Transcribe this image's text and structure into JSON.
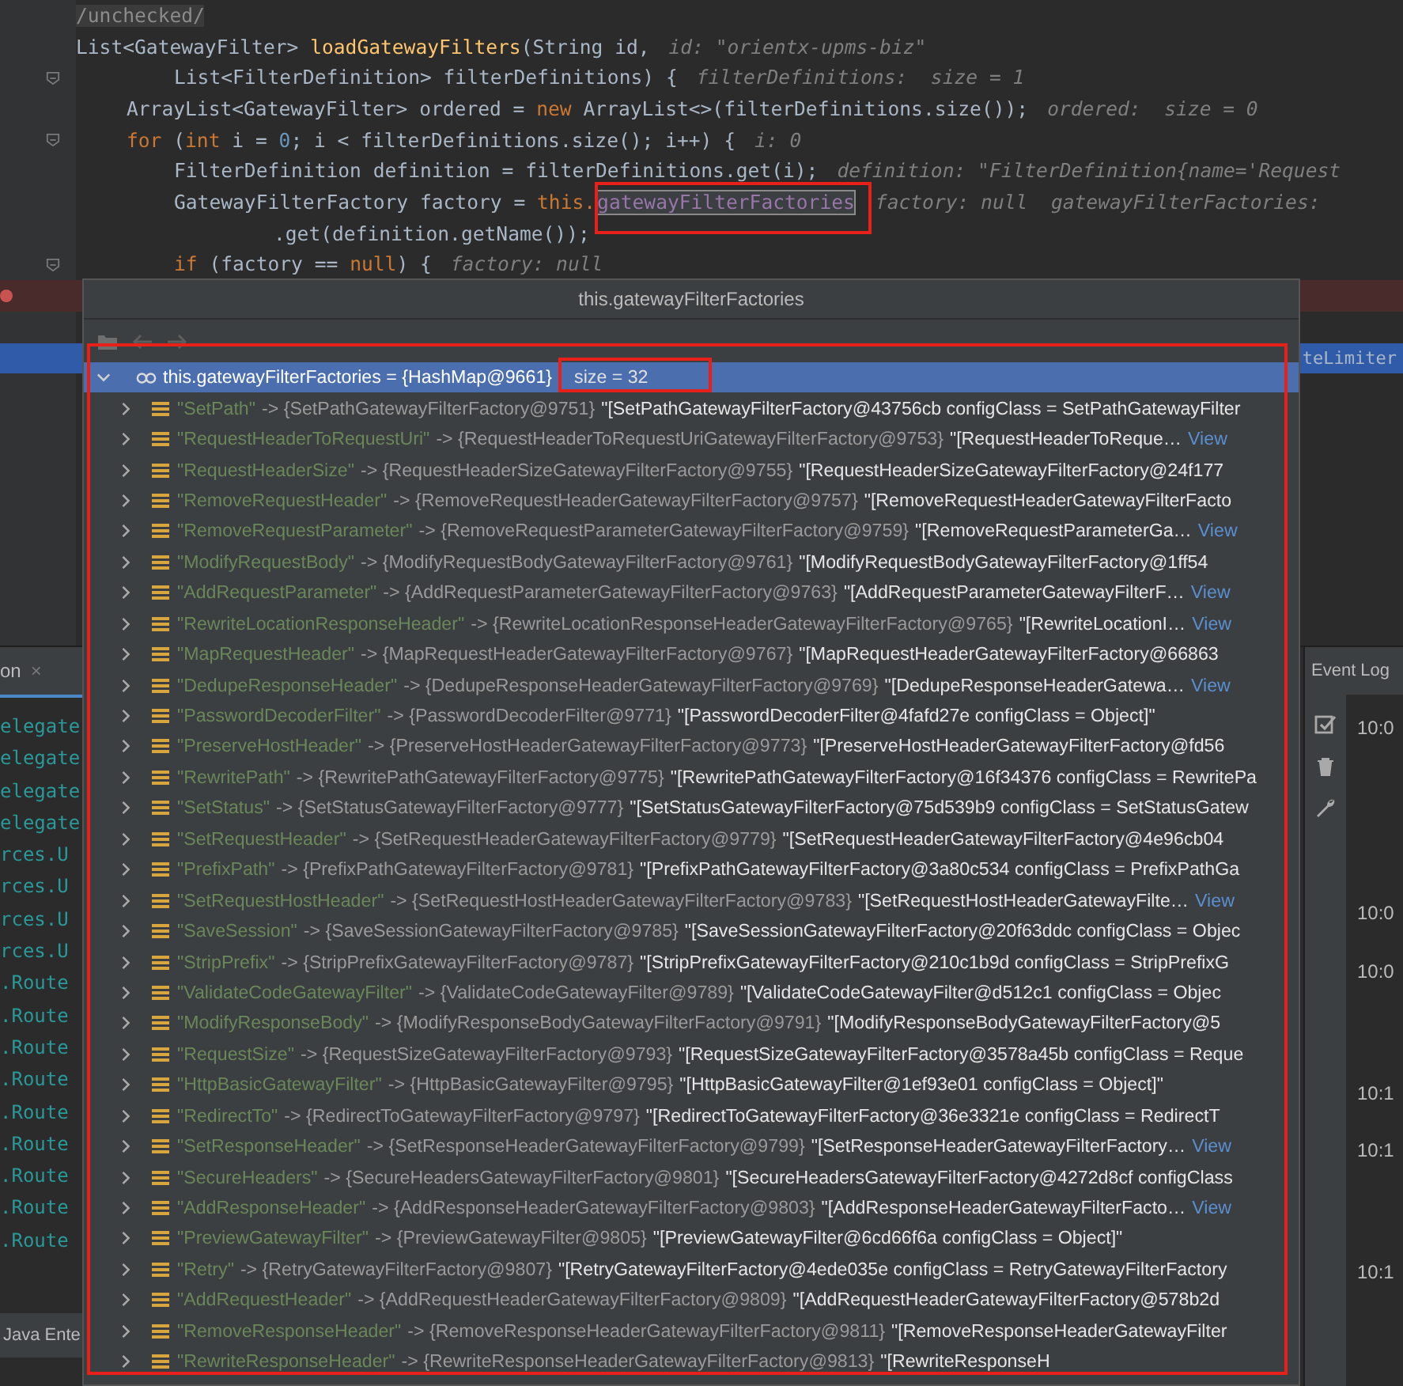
{
  "editor": {
    "lines": [
      {
        "kind": "normal",
        "segments": [
          {
            "kind": "comment",
            "text": "/unchecked/"
          }
        ]
      },
      {
        "kind": "normal",
        "segments": [
          {
            "kind": "plain",
            "text": "List<GatewayFilter> "
          },
          {
            "kind": "fn",
            "text": "loadGatewayFilters"
          },
          {
            "kind": "plain",
            "text": "(String id,"
          },
          {
            "kind": "hint",
            "text": "id: \"orientx-upms-biz\""
          }
        ]
      },
      {
        "kind": "normal",
        "fold": true,
        "segments": [
          {
            "kind": "plain",
            "text": "List<FilterDefinition> filterDefinitions) {"
          },
          {
            "kind": "hint",
            "text": "filterDefinitions:  size = 1"
          }
        ]
      },
      {
        "kind": "normal",
        "segments": [
          {
            "kind": "plain",
            "text": "ArrayList<GatewayFilter> ordered = "
          },
          {
            "kind": "kw",
            "text": "new"
          },
          {
            "kind": "plain",
            "text": " ArrayList<>(filterDefinitions.size());"
          },
          {
            "kind": "hint",
            "text": "ordered:  size = 0"
          }
        ]
      },
      {
        "kind": "normal",
        "fold": true,
        "segments": [
          {
            "kind": "kw",
            "text": "for"
          },
          {
            "kind": "plain",
            "text": " ("
          },
          {
            "kind": "kw",
            "text": "int"
          },
          {
            "kind": "plain",
            "text": " i = "
          },
          {
            "kind": "num",
            "text": "0"
          },
          {
            "kind": "plain",
            "text": "; i < filterDefinitions.size(); i++) {"
          },
          {
            "kind": "hint",
            "text": "i: 0"
          }
        ]
      },
      {
        "kind": "normal",
        "segments": [
          {
            "kind": "plain",
            "text": "FilterDefinition definition = filterDefinitions.get(i);"
          },
          {
            "kind": "hint",
            "text": "definition: \"FilterDefinition{name='Request"
          }
        ]
      },
      {
        "kind": "normal",
        "segments": [
          {
            "kind": "plain",
            "text": "GatewayFilterFactory factory = "
          },
          {
            "kind": "kw",
            "text": "this."
          },
          {
            "kind": "field",
            "text": "gatewayFilterFactories"
          },
          {
            "kind": "hint",
            "text": "factory: null  gatewayFilterFactories:"
          }
        ]
      },
      {
        "kind": "normal",
        "segments": [
          {
            "kind": "plain",
            "text": ".get(definition.getName());"
          }
        ]
      },
      {
        "kind": "normal",
        "fold": true,
        "segments": [
          {
            "kind": "kw",
            "text": "if"
          },
          {
            "kind": "plain",
            "text": " (factory == "
          },
          {
            "kind": "kw",
            "text": "null"
          },
          {
            "kind": "plain",
            "text": ") {"
          },
          {
            "kind": "hint",
            "text": "factory: null"
          }
        ]
      },
      {
        "kind": "breakpoint"
      },
      {
        "kind": "normal"
      },
      {
        "kind": "current",
        "segments": [
          {
            "kind": "plain",
            "text": "teLimiter"
          }
        ]
      }
    ]
  },
  "popup": {
    "title": "this.gatewayFilterFactories",
    "root": {
      "name": "this.gatewayFilterFactories = {HashMap@9661}",
      "size": "size = 32",
      "expanded": true,
      "selected": true,
      "children": [
        {
          "key": "\"SetPath\"",
          "ref": "-> {SetPathGatewayFilterFactory@9751}",
          "text": "\"[SetPathGatewayFilterFactory@43756cb configClass = SetPathGatewayFilter",
          "expanded": false
        },
        {
          "key": "\"RequestHeaderToRequestUri\"",
          "ref": "-> {RequestHeaderToRequestUriGatewayFilterFactory@9753}",
          "text": "\"[RequestHeaderToReque…",
          "link": "View",
          "expanded": false
        },
        {
          "key": "\"RequestHeaderSize\"",
          "ref": "-> {RequestHeaderSizeGatewayFilterFactory@9755}",
          "text": "\"[RequestHeaderSizeGatewayFilterFactory@24f177",
          "expanded": false
        },
        {
          "key": "\"RemoveRequestHeader\"",
          "ref": "-> {RemoveRequestHeaderGatewayFilterFactory@9757}",
          "text": "\"[RemoveRequestHeaderGatewayFilterFacto",
          "expanded": false
        },
        {
          "key": "\"RemoveRequestParameter\"",
          "ref": "-> {RemoveRequestParameterGatewayFilterFactory@9759}",
          "text": "\"[RemoveRequestParameterGa…",
          "link": "View",
          "expanded": false
        },
        {
          "key": "\"ModifyRequestBody\"",
          "ref": "-> {ModifyRequestBodyGatewayFilterFactory@9761}",
          "text": "\"[ModifyRequestBodyGatewayFilterFactory@1ff54",
          "expanded": false
        },
        {
          "key": "\"AddRequestParameter\"",
          "ref": "-> {AddRequestParameterGatewayFilterFactory@9763}",
          "text": "\"[AddRequestParameterGatewayFilterF…",
          "link": "View",
          "expanded": false
        },
        {
          "key": "\"RewriteLocationResponseHeader\"",
          "ref": "-> {RewriteLocationResponseHeaderGatewayFilterFactory@9765}",
          "text": "\"[RewriteLocationI…",
          "link": "View",
          "expanded": false
        },
        {
          "key": "\"MapRequestHeader\"",
          "ref": "-> {MapRequestHeaderGatewayFilterFactory@9767}",
          "text": "\"[MapRequestHeaderGatewayFilterFactory@66863",
          "expanded": false
        },
        {
          "key": "\"DedupeResponseHeader\"",
          "ref": "-> {DedupeResponseHeaderGatewayFilterFactory@9769}",
          "text": "\"[DedupeResponseHeaderGatewa…",
          "link": "View",
          "expanded": false
        },
        {
          "key": "\"PasswordDecoderFilter\"",
          "ref": "-> {PasswordDecoderFilter@9771}",
          "text": "\"[PasswordDecoderFilter@4fafd27e configClass = Object]\"",
          "expanded": false
        },
        {
          "key": "\"PreserveHostHeader\"",
          "ref": "-> {PreserveHostHeaderGatewayFilterFactory@9773}",
          "text": "\"[PreserveHostHeaderGatewayFilterFactory@fd56",
          "expanded": false
        },
        {
          "key": "\"RewritePath\"",
          "ref": "-> {RewritePathGatewayFilterFactory@9775}",
          "text": "\"[RewritePathGatewayFilterFactory@16f34376 configClass = RewritePa",
          "expanded": false
        },
        {
          "key": "\"SetStatus\"",
          "ref": "-> {SetStatusGatewayFilterFactory@9777}",
          "text": "\"[SetStatusGatewayFilterFactory@75d539b9 configClass = SetStatusGatew",
          "expanded": false
        },
        {
          "key": "\"SetRequestHeader\"",
          "ref": "-> {SetRequestHeaderGatewayFilterFactory@9779}",
          "text": "\"[SetRequestHeaderGatewayFilterFactory@4e96cb04",
          "expanded": false
        },
        {
          "key": "\"PrefixPath\"",
          "ref": "-> {PrefixPathGatewayFilterFactory@9781}",
          "text": "\"[PrefixPathGatewayFilterFactory@3a80c534 configClass = PrefixPathGa",
          "expanded": false
        },
        {
          "key": "\"SetRequestHostHeader\"",
          "ref": "-> {SetRequestHostHeaderGatewayFilterFactory@9783}",
          "text": "\"[SetRequestHostHeaderGatewayFilte…",
          "link": "View",
          "expanded": false
        },
        {
          "key": "\"SaveSession\"",
          "ref": "-> {SaveSessionGatewayFilterFactory@9785}",
          "text": "\"[SaveSessionGatewayFilterFactory@20f63ddc configClass = Objec",
          "expanded": false
        },
        {
          "key": "\"StripPrefix\"",
          "ref": "-> {StripPrefixGatewayFilterFactory@9787}",
          "text": "\"[StripPrefixGatewayFilterFactory@210c1b9d configClass = StripPrefixG",
          "expanded": false
        },
        {
          "key": "\"ValidateCodeGatewayFilter\"",
          "ref": "-> {ValidateCodeGatewayFilter@9789}",
          "text": "\"[ValidateCodeGatewayFilter@d512c1 configClass = Objec",
          "expanded": false
        },
        {
          "key": "\"ModifyResponseBody\"",
          "ref": "-> {ModifyResponseBodyGatewayFilterFactory@9791}",
          "text": "\"[ModifyResponseBodyGatewayFilterFactory@5",
          "expanded": false
        },
        {
          "key": "\"RequestSize\"",
          "ref": "-> {RequestSizeGatewayFilterFactory@9793}",
          "text": "\"[RequestSizeGatewayFilterFactory@3578a45b configClass = Reque",
          "expanded": false
        },
        {
          "key": "\"HttpBasicGatewayFilter\"",
          "ref": "-> {HttpBasicGatewayFilter@9795}",
          "text": "\"[HttpBasicGatewayFilter@1ef93e01 configClass = Object]\"",
          "expanded": false
        },
        {
          "key": "\"RedirectTo\"",
          "ref": "-> {RedirectToGatewayFilterFactory@9797}",
          "text": "\"[RedirectToGatewayFilterFactory@36e3321e configClass = RedirectT",
          "expanded": false
        },
        {
          "key": "\"SetResponseHeader\"",
          "ref": "-> {SetResponseHeaderGatewayFilterFactory@9799}",
          "text": "\"[SetResponseHeaderGatewayFilterFactory…",
          "link": "View",
          "expanded": false
        },
        {
          "key": "\"SecureHeaders\"",
          "ref": "-> {SecureHeadersGatewayFilterFactory@9801}",
          "text": "\"[SecureHeadersGatewayFilterFactory@4272d8cf configClass",
          "expanded": false
        },
        {
          "key": "\"AddResponseHeader\"",
          "ref": "-> {AddResponseHeaderGatewayFilterFactory@9803}",
          "text": "\"[AddResponseHeaderGatewayFilterFacto…",
          "link": "View",
          "expanded": false
        },
        {
          "key": "\"PreviewGatewayFilter\"",
          "ref": "-> {PreviewGatewayFilter@9805}",
          "text": "\"[PreviewGatewayFilter@6cd66f6a configClass = Object]\"",
          "expanded": false
        },
        {
          "key": "\"Retry\"",
          "ref": "-> {RetryGatewayFilterFactory@9807}",
          "text": "\"[RetryGatewayFilterFactory@4ede035e configClass = RetryGatewayFilterFactory",
          "expanded": false
        },
        {
          "key": "\"AddRequestHeader\"",
          "ref": "-> {AddRequestHeaderGatewayFilterFactory@9809}",
          "text": "\"[AddRequestHeaderGatewayFilterFactory@578b2d",
          "expanded": false
        },
        {
          "key": "\"RemoveResponseHeader\"",
          "ref": "-> {RemoveResponseHeaderGatewayFilterFactory@9811}",
          "text": "\"[RemoveResponseHeaderGatewayFilter",
          "expanded": false
        },
        {
          "key": "\"RewriteResponseHeader\"",
          "ref": "-> {RewriteResponseHeaderGatewayFilterFactory@9813}",
          "text": "\"[RewriteResponseH",
          "expanded": false
        }
      ]
    }
  },
  "debug_panel": {
    "tab": "on",
    "close": "×",
    "lines": [
      "elegate",
      "elegate",
      "elegate",
      "elegate",
      "rces.U",
      "rces.U",
      "rces.U",
      "rces.U",
      ".Route",
      ".Route",
      ".Route",
      ".Route",
      ".Route",
      ".Route",
      ".Route",
      ".Route",
      ".Route"
    ],
    "bottom_tab": "Java Ente"
  },
  "event_log": {
    "tab": "Event Log",
    "entries": [
      "10:0",
      "10:0",
      "10:0",
      "10:1",
      "10:1",
      "10:1"
    ]
  }
}
